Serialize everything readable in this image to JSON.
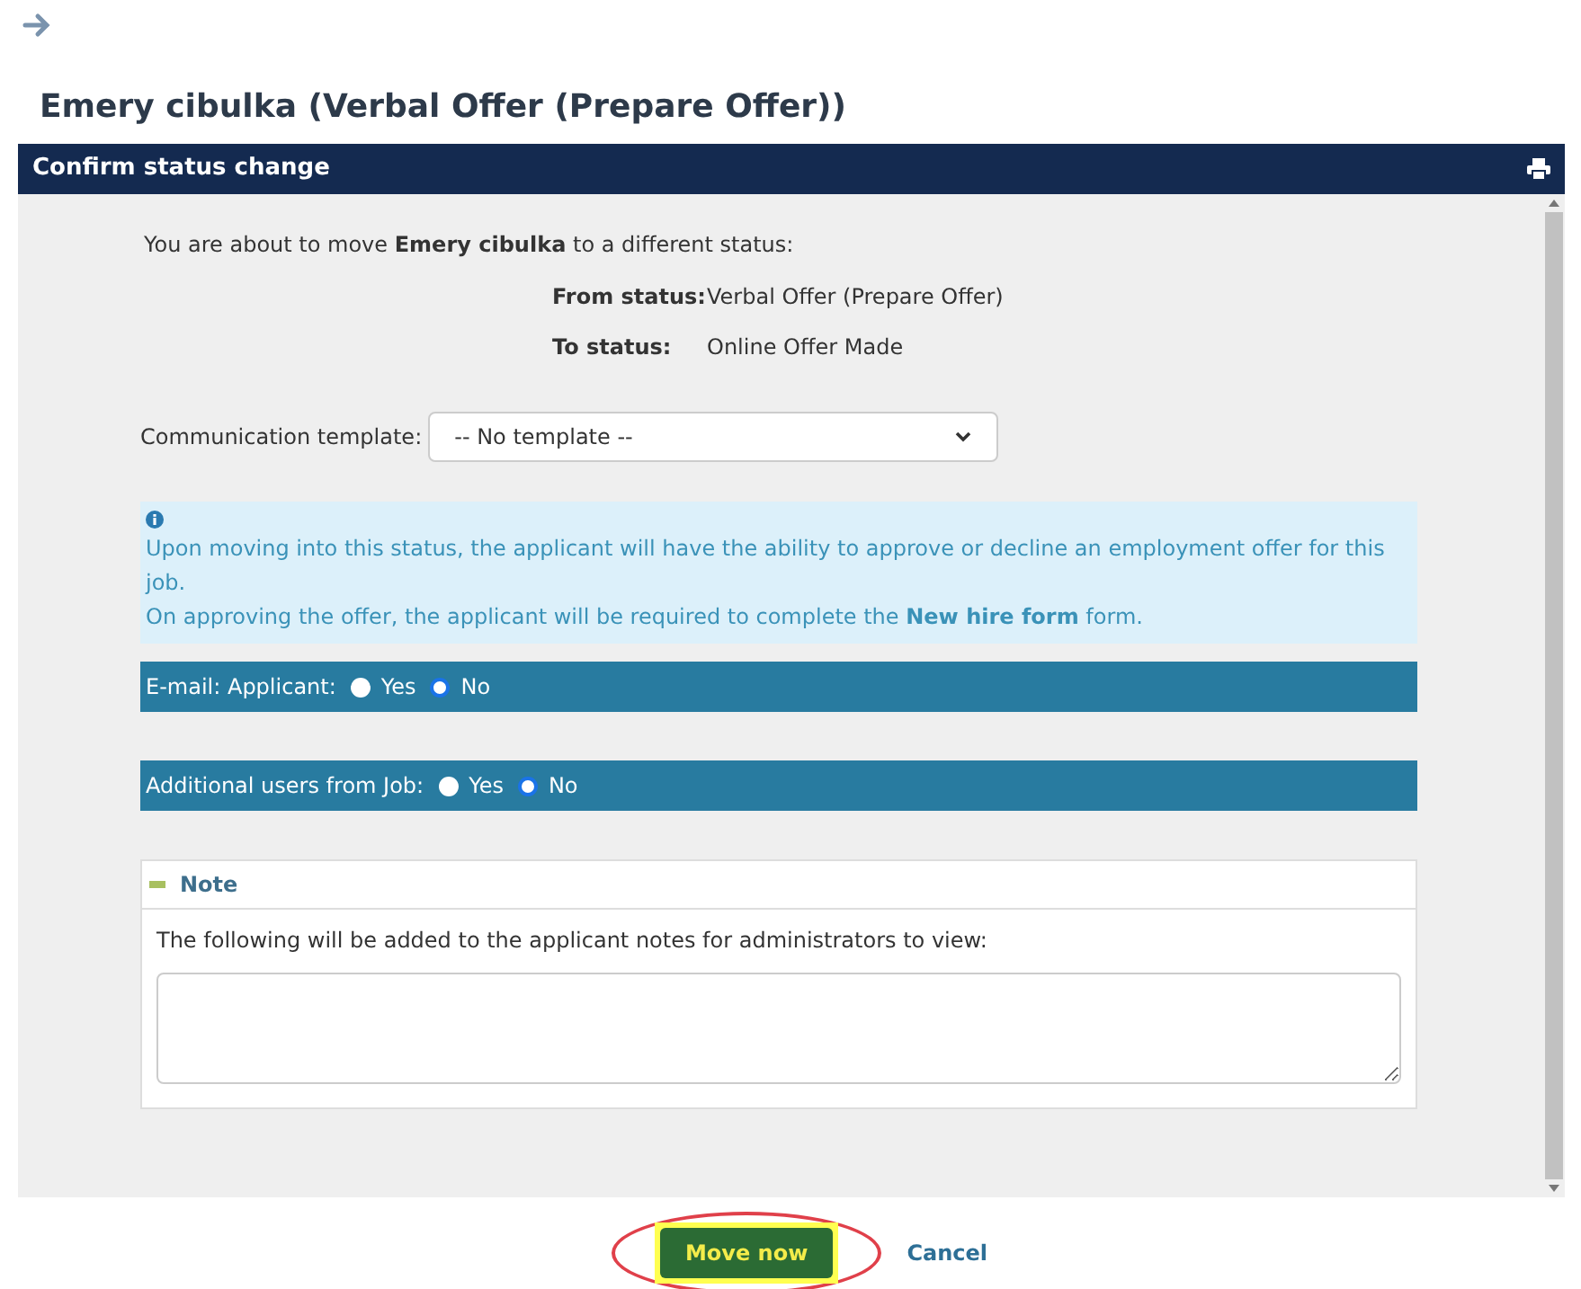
{
  "page_title": "Emery cibulka (Verbal Offer (Prepare Offer))",
  "dialog": {
    "title": "Confirm status change",
    "intro": "You are about to move **Emery cibulka** to a different status:",
    "status_rows": [
      {
        "label": "From status:",
        "value": "Verbal Offer (Prepare Offer)"
      },
      {
        "label": "To status:",
        "value": "Online Offer Made"
      }
    ],
    "template": {
      "label": "Communication template:",
      "value": "-- No template --"
    },
    "info": [
      "Upon moving into this status, the applicant will have the ability to approve or decline an employment offer for this job.",
      "On approving the offer, the applicant will be required to complete the **New hire form** form."
    ],
    "radio_groups": [
      {
        "label": "E-mail: Applicant:",
        "options": [
          {
            "label": "Yes",
            "selected": false
          },
          {
            "label": "No",
            "selected": true
          }
        ]
      },
      {
        "label": "Additional users from Job:",
        "options": [
          {
            "label": "Yes",
            "selected": false
          },
          {
            "label": "No",
            "selected": true
          }
        ]
      }
    ],
    "note": {
      "title": "Note",
      "expanded": true,
      "text": "The following will be added to the applicant notes for administrators to view:"
    }
  },
  "buttons": [
    {
      "label": "Move now",
      "kind": "primary",
      "highlighted": true
    },
    {
      "label": "Cancel",
      "kind": "link",
      "highlighted": false
    }
  ]
}
